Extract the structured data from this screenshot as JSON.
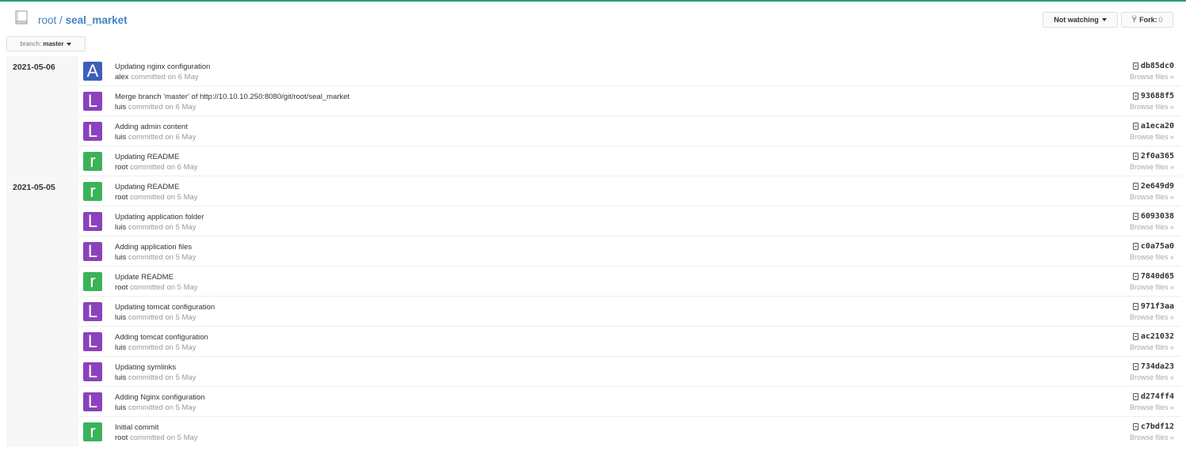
{
  "repo": {
    "owner": "root",
    "separator": "/",
    "name": "seal_market"
  },
  "header": {
    "watch_label": "Not watching",
    "fork_label": "Fork:",
    "fork_count": "0"
  },
  "branch": {
    "prefix": "branch:",
    "name": "master"
  },
  "groups": [
    {
      "date": "2021-05-06",
      "commits": [
        {
          "message": "Updating nginx configuration",
          "author": "alex",
          "committed_text": "committed on 6 May",
          "sha": "db85dc0",
          "browse": "Browse files »",
          "avatar_letter": "A",
          "avatar_color": "#3d5fb8"
        },
        {
          "message": "Merge branch 'master' of http://10.10.10.250:8080/git/root/seal_market",
          "author": "luis",
          "committed_text": "committed on 6 May",
          "sha": "93688f5",
          "browse": "Browse files »",
          "avatar_letter": "L",
          "avatar_color": "#8a42bc"
        },
        {
          "message": "Adding admin content",
          "author": "luis",
          "committed_text": "committed on 6 May",
          "sha": "a1eca20",
          "browse": "Browse files »",
          "avatar_letter": "L",
          "avatar_color": "#8a42bc"
        },
        {
          "message": "Updating README",
          "author": "root",
          "committed_text": "committed on 6 May",
          "sha": "2f0a365",
          "browse": "Browse files »",
          "avatar_letter": "r",
          "avatar_color": "#3bb25a"
        }
      ]
    },
    {
      "date": "2021-05-05",
      "commits": [
        {
          "message": "Updating README",
          "author": "root",
          "committed_text": "committed on 5 May",
          "sha": "2e649d9",
          "browse": "Browse files »",
          "avatar_letter": "r",
          "avatar_color": "#3bb25a"
        },
        {
          "message": "Updating application folder",
          "author": "luis",
          "committed_text": "committed on 5 May",
          "sha": "6093038",
          "browse": "Browse files »",
          "avatar_letter": "L",
          "avatar_color": "#8a42bc"
        },
        {
          "message": "Adding application files",
          "author": "luis",
          "committed_text": "committed on 5 May",
          "sha": "c0a75a0",
          "browse": "Browse files »",
          "avatar_letter": "L",
          "avatar_color": "#8a42bc"
        },
        {
          "message": "Update README",
          "author": "root",
          "committed_text": "committed on 5 May",
          "sha": "7840d65",
          "browse": "Browse files »",
          "avatar_letter": "r",
          "avatar_color": "#3bb25a"
        },
        {
          "message": "Updating tomcat configuration",
          "author": "luis",
          "committed_text": "committed on 5 May",
          "sha": "971f3aa",
          "browse": "Browse files »",
          "avatar_letter": "L",
          "avatar_color": "#8a42bc"
        },
        {
          "message": "Adding tomcat configuration",
          "author": "luis",
          "committed_text": "committed on 5 May",
          "sha": "ac21032",
          "browse": "Browse files »",
          "avatar_letter": "L",
          "avatar_color": "#8a42bc"
        },
        {
          "message": "Updating symlinks",
          "author": "luis",
          "committed_text": "committed on 5 May",
          "sha": "734da23",
          "browse": "Browse files »",
          "avatar_letter": "L",
          "avatar_color": "#8a42bc"
        },
        {
          "message": "Adding Nginx configuration",
          "author": "luis",
          "committed_text": "committed on 5 May",
          "sha": "d274ff4",
          "browse": "Browse files »",
          "avatar_letter": "L",
          "avatar_color": "#8a42bc"
        },
        {
          "message": "Initial commit",
          "author": "root",
          "committed_text": "committed on 5 May",
          "sha": "c7bdf12",
          "browse": "Browse files »",
          "avatar_letter": "r",
          "avatar_color": "#3bb25a"
        }
      ]
    }
  ]
}
